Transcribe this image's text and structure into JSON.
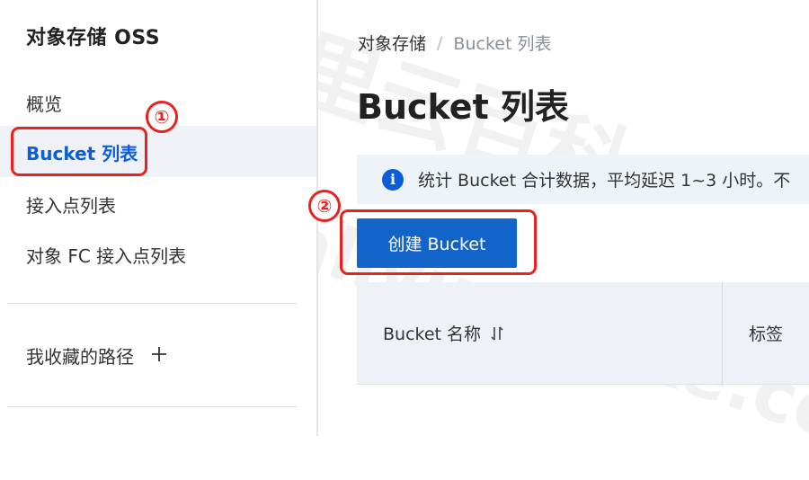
{
  "sidebar": {
    "title": "对象存储 OSS",
    "items": [
      {
        "label": "概览"
      },
      {
        "label": "Bucket 列表"
      },
      {
        "label": "接入点列表"
      },
      {
        "label": "对象 FC 接入点列表"
      }
    ],
    "favorites_label": "我收藏的路径",
    "favorites_add_icon": "plus-icon"
  },
  "breadcrumb": {
    "root": "对象存储",
    "separator": "/",
    "current": "Bucket 列表"
  },
  "main": {
    "title": "Bucket 列表",
    "info_text": "统计 Bucket 合计数据，平均延迟 1~3 小时。不",
    "create_button": "创建 Bucket",
    "table": {
      "columns": [
        "Bucket 名称",
        "标签"
      ]
    }
  },
  "annotations": {
    "badge1": "①",
    "badge2": "②"
  },
  "watermark": {
    "line1": "阿里云百科",
    "line2": "aliyunbaike.com"
  },
  "colors": {
    "accent": "#1264c9",
    "active_text": "#0b5ed7",
    "highlight": "#e8221f"
  }
}
